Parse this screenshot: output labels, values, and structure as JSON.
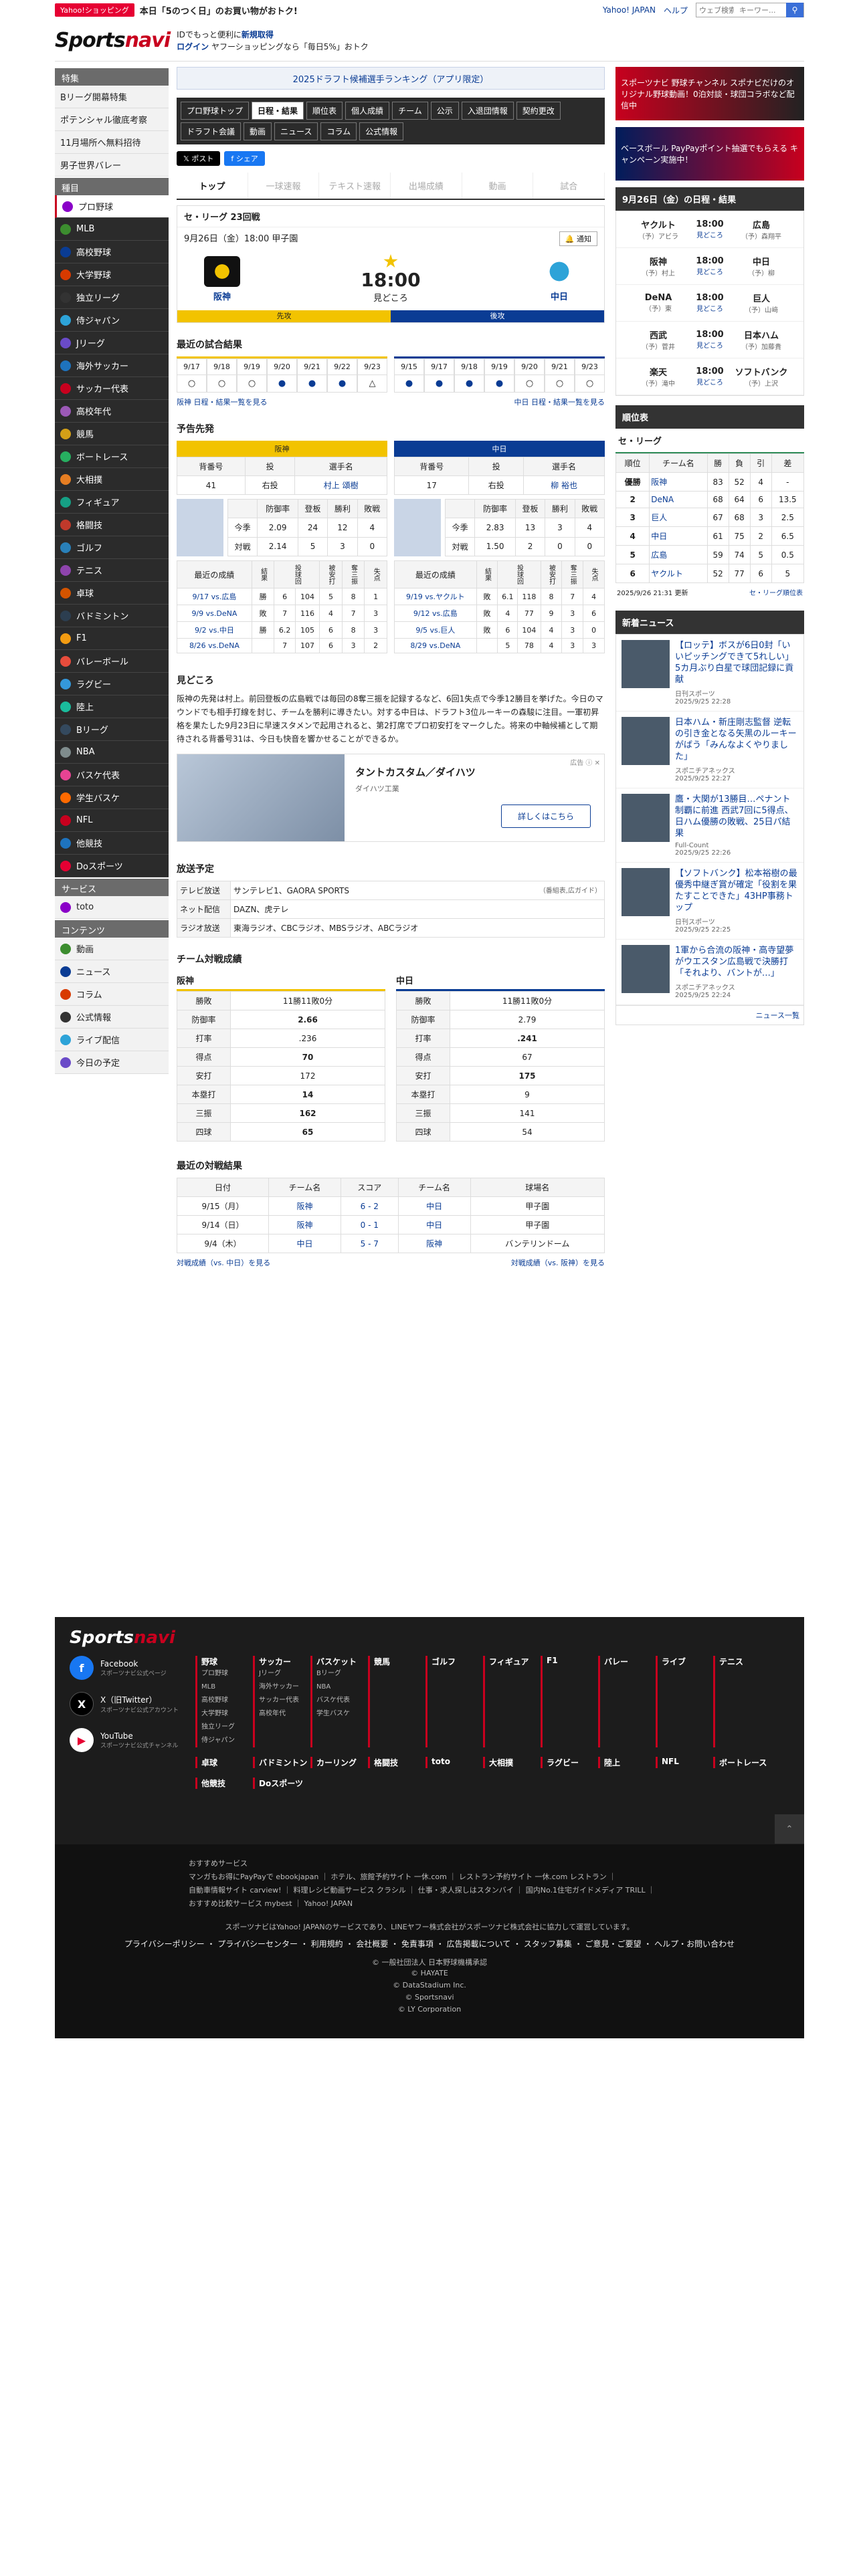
{
  "topbar": {
    "badge": "Yahoo!ショッピング",
    "promo": "本日「5のつく日」のお買い物がおトク!",
    "links": [
      "Yahoo! JAPAN",
      "ヘルプ"
    ],
    "search_placeholder": "ウェブ検索",
    "search_placeholder2": "キーワー..."
  },
  "header": {
    "logo_a": "Sports",
    "logo_b": "navi",
    "line1": "IDでもっと便利に",
    "line1b": "新規取得",
    "line2": "ログイン",
    "line2b": "ヤフーショッピングなら「毎日5%」おトク"
  },
  "sidebar": {
    "sections": [
      {
        "title": "特集",
        "items": [
          "Bリーグ開幕特集",
          "ポテンシャル徹底考察",
          "11月場所へ無料招待",
          "男子世界バレー"
        ]
      },
      {
        "title": "種目",
        "items": [
          "プロ野球",
          "MLB",
          "高校野球",
          "大学野球",
          "独立リーグ",
          "侍ジャパン",
          "Jリーグ",
          "海外サッカー",
          "サッカー代表",
          "高校年代",
          "競馬",
          "ボートレース",
          "大相撲",
          "フィギュア",
          "格闘技",
          "ゴルフ",
          "テニス",
          "卓球",
          "バドミントン",
          "F1",
          "バレーボール",
          "ラグビー",
          "陸上",
          "Bリーグ",
          "NBA",
          "バスケ代表",
          "学生バスケ",
          "NFL",
          "他競技",
          "Doスポーツ"
        ]
      },
      {
        "title": "サービス",
        "items": [
          "toto"
        ]
      },
      {
        "title": "コンテンツ",
        "items": [
          "動画",
          "ニュース",
          "コラム",
          "公式情報",
          "ライブ配信",
          "今日の予定"
        ]
      }
    ],
    "icon_colors": [
      "#ff6a00",
      "#c8001e",
      "#1e73be",
      "#e60033",
      "#8a00c8",
      "#3c8d2f",
      "#0a3c94",
      "#d83a00",
      "#333",
      "#2da3d8",
      "#6a4bc8",
      "#1e73be",
      "#c8001e",
      "#9b59b6",
      "#d4a017",
      "#27ae60",
      "#e67e22",
      "#16a085",
      "#c0392b",
      "#2980b9",
      "#8e44ad",
      "#d35400",
      "#2c3e50",
      "#f39c12",
      "#e74c3c",
      "#3498db",
      "#1abc9c",
      "#34495e",
      "#7f8c8d",
      "#e84393"
    ]
  },
  "main": {
    "rank_banner": "2025ドラフト候補選手ランキング（アプリ限定）",
    "tabs": [
      "プロ野球トップ",
      "日程・結果",
      "順位表",
      "個人成績",
      "チーム",
      "公示",
      "入退団情報",
      "契約更改",
      "ドラフト会議",
      "動画",
      "ニュース",
      "コラム",
      "公式情報"
    ],
    "share": [
      "𝕏 ポスト",
      "f シェア"
    ],
    "subtabs": [
      "トップ",
      "一球速報",
      "テキスト速報",
      "出場成績",
      "動画",
      "試合"
    ],
    "game": {
      "league": "セ・リーグ 23回戦",
      "date": "9月26日（金）18:00 甲子園",
      "notify": "通知",
      "home": "阪神",
      "away": "中日",
      "time": "18:00",
      "status": "見どころ",
      "home_sp": "先攻",
      "away_sp": "後攻"
    },
    "recent": {
      "title": "最近の試合結果",
      "left_dates": [
        "9/17",
        "9/18",
        "9/19",
        "9/20",
        "9/21",
        "9/22",
        "9/23"
      ],
      "left_marks": [
        "○",
        "○",
        "○",
        "●",
        "●",
        "●",
        "△"
      ],
      "right_dates": [
        "9/15",
        "9/17",
        "9/18",
        "9/19",
        "9/20",
        "9/21",
        "9/23"
      ],
      "right_marks": [
        "●",
        "●",
        "●",
        "●",
        "○",
        "○",
        "○"
      ],
      "left_link": "阪神 日程・結果一覧を見る",
      "right_link": "中日 日程・結果一覧を見る"
    },
    "pitchers": {
      "title": "予告先発",
      "left": {
        "team": "阪神",
        "h_no": "背番号",
        "h_pos": "投",
        "h_name": "選手名",
        "no": "41",
        "pos": "右投",
        "name": "村上 頌樹",
        "cols": [
          "防御率",
          "登板",
          "勝利",
          "敗戦"
        ],
        "rows": [
          [
            "今季",
            "2.09",
            "24",
            "12",
            "4"
          ],
          [
            "対戦",
            "2.14",
            "5",
            "3",
            "0"
          ]
        ],
        "games_h": "最近の成績",
        "gcols": [
          "結果",
          "投球回",
          "被安打",
          "奪三振",
          "失点"
        ],
        "games": [
          [
            "9/17 vs.広島",
            "勝",
            "6",
            "104",
            "5",
            "8",
            "1"
          ],
          [
            "9/9 vs.DeNA",
            "敗",
            "7",
            "116",
            "4",
            "7",
            "3"
          ],
          [
            "9/2 vs.中日",
            "勝",
            "6.2",
            "105",
            "6",
            "8",
            "3"
          ],
          [
            "8/26 vs.DeNA",
            "",
            "7",
            "107",
            "6",
            "3",
            "2"
          ]
        ]
      },
      "right": {
        "team": "中日",
        "h_no": "背番号",
        "h_pos": "投",
        "h_name": "選手名",
        "no": "17",
        "pos": "右投",
        "name": "柳 裕也",
        "cols": [
          "防御率",
          "登板",
          "勝利",
          "敗戦"
        ],
        "rows": [
          [
            "今季",
            "2.83",
            "13",
            "3",
            "4"
          ],
          [
            "対戦",
            "1.50",
            "2",
            "0",
            "0"
          ]
        ],
        "games_h": "最近の成績",
        "gcols": [
          "結果",
          "投球回",
          "被安打",
          "奪三振",
          "失点"
        ],
        "games": [
          [
            "9/19 vs.ヤクルト",
            "敗",
            "6.1",
            "118",
            "8",
            "7",
            "4"
          ],
          [
            "9/12 vs.広島",
            "敗",
            "4",
            "77",
            "9",
            "3",
            "6"
          ],
          [
            "9/5 vs.巨人",
            "敗",
            "6",
            "104",
            "4",
            "3",
            "0"
          ],
          [
            "8/29 vs.DeNA",
            "",
            "5",
            "78",
            "4",
            "3",
            "3"
          ]
        ]
      }
    },
    "highlights": {
      "title": "見どころ",
      "text": "阪神の先発は村上。前回登板の広島戦では毎回の8奪三振を記録するなど、6回1失点で今季12勝目を挙げた。今日のマウンドでも相手打線を封じ、チームを勝利に導きたい。対する中日は、ドラフト3位ルーキーの森駿に注目。一軍初昇格を果たした9月23日に早速スタメンで起用されると、第2打席でプロ初安打をマークした。将来の中軸候補として期待される背番号31は、今日も快音を響かせることができるか。"
    },
    "ad": {
      "label": "広告 ⓘ ✕",
      "title": "タントカスタム／ダイハツ",
      "sub": "ダイハツ工業",
      "button": "詳しくはこちら"
    },
    "broadcast": {
      "title": "放送予定",
      "rows": [
        [
          "テレビ放送",
          "サンテレビ1、GAORA SPORTS"
        ],
        [
          "ネット配信",
          "DAZN、虎テレ"
        ],
        [
          "ラジオ放送",
          "東海ラジオ、CBCラジオ、MBSラジオ、ABCラジオ"
        ]
      ],
      "guide": "（番組表,広ガイド）"
    },
    "stats": {
      "title": "チーム対戦成績",
      "left_team": "阪神",
      "right_team": "中日",
      "labels": [
        "勝敗",
        "防御率",
        "打率",
        "得点",
        "安打",
        "本塁打",
        "三振",
        "四球"
      ],
      "left": [
        "11勝11敗0分",
        "2.66",
        ".236",
        "70",
        "172",
        "14",
        "162",
        "65"
      ],
      "right": [
        "11勝11敗0分",
        "2.79",
        ".241",
        "67",
        "175",
        "9",
        "141",
        "54"
      ]
    },
    "vs": {
      "title": "最近の対戦結果",
      "headers": [
        "日付",
        "チーム名",
        "スコア",
        "チーム名",
        "球場名"
      ],
      "rows": [
        [
          "9/15（月）",
          "阪神",
          "6 - 2",
          "中日",
          "甲子園"
        ],
        [
          "9/14（日）",
          "阪神",
          "0 - 1",
          "中日",
          "甲子園"
        ],
        [
          "9/4（木）",
          "中日",
          "5 - 7",
          "阪神",
          "バンテリンドーム"
        ]
      ],
      "left_link": "対戦成績（vs. 中日）を見る",
      "right_link": "対戦成績（vs. 阪神）を見る"
    }
  },
  "right": {
    "banner1": "スポーツナビ 野球チャンネル スポナビだけのオリジナル野球動画！0泊対談・球団コラボなど配信中",
    "banner2": "ベースボール PayPayポイント抽選でもらえる キャンペーン実施中！",
    "games_title": "9月26日（金）の日程・結果",
    "games": [
      [
        "ヤクルト",
        "（予）アビラ",
        "18:00",
        "見どころ",
        "広島",
        "（予）森翔平"
      ],
      [
        "阪神",
        "（予）村上",
        "18:00",
        "見どころ",
        "中日",
        "（予）柳"
      ],
      [
        "DeNA",
        "（予）東",
        "18:00",
        "見どころ",
        "巨人",
        "（予）山﨑"
      ],
      [
        "西武",
        "（予）菅井",
        "18:00",
        "見どころ",
        "日本ハム",
        "（予）加藤貴"
      ],
      [
        "楽天",
        "（予）滝中",
        "18:00",
        "見どころ",
        "ソフトバンク",
        "（予）上沢"
      ]
    ],
    "stand_title": "順位表",
    "stand_tab": "セ・リーグ",
    "stand_headers": [
      "順位",
      "チーム名",
      "勝",
      "負",
      "引",
      "差"
    ],
    "standings": [
      [
        "優勝",
        "阪神",
        "83",
        "52",
        "4",
        "-"
      ],
      [
        "2",
        "DeNA",
        "68",
        "64",
        "6",
        "13.5"
      ],
      [
        "3",
        "巨人",
        "67",
        "68",
        "3",
        "2.5"
      ],
      [
        "4",
        "中日",
        "61",
        "75",
        "2",
        "6.5"
      ],
      [
        "5",
        "広島",
        "59",
        "74",
        "5",
        "0.5"
      ],
      [
        "6",
        "ヤクルト",
        "52",
        "77",
        "6",
        "5"
      ]
    ],
    "stand_update": "2025/9/26 21:31 更新",
    "stand_link": "セ・リーグ順位表",
    "news_title": "新着ニュース",
    "news": [
      [
        "【ロッテ】ボスが6日0封「いいピッチングできて5れしい」5カ月ぶり白星で球団記録に貢献",
        "日刊スポーツ",
        "2025/9/25 22:28"
      ],
      [
        "日本ハム・新庄剛志監督 逆転の引き金となる矢黒のルーキーがばう「みんなよくやりました」",
        "スポニチアネックス",
        "2025/9/25 22:27"
      ],
      [
        "鷹・大関が13勝目…ペナント制覇に前進 西武7回に5得点、日ハム優勝の敗戦、25日パ結果",
        "Full-Count",
        "2025/9/25 22:26"
      ],
      [
        "【ソフトバンク】松本裕樹の最優秀中継ぎ賞が確定「役割を果たすことできた」43HP事務トップ",
        "日刊スポーツ",
        "2025/9/25 22:25"
      ],
      [
        "1軍から合流の阪神・高寺望夢がウエスタン広島戦で決勝打「それより、バントが…」",
        "スポニチアネックス",
        "2025/9/25 22:24"
      ]
    ],
    "news_more": "ニュース一覧"
  },
  "footer": {
    "logo_a": "Sports",
    "logo_b": "navi",
    "social": [
      [
        "Facebook",
        "スポーツナビ公式ページ"
      ],
      [
        "X（旧Twitter）",
        "スポーツナビ公式アカウント"
      ],
      [
        "YouTube",
        "スポーツナビ公式チャンネル"
      ]
    ],
    "cols": [
      [
        "野球",
        "プロ野球 MLB 高校野球 大学野球 独立リーグ 侍ジャパン"
      ],
      [
        "サッカー",
        "Jリーグ 海外サッカー サッカー代表 高校年代"
      ],
      [
        "バスケット",
        "Bリーグ NBA バスケ代表 学生バスケ"
      ],
      [
        "競馬",
        ""
      ],
      [
        "ゴルフ",
        ""
      ],
      [
        "フィギュア",
        ""
      ],
      [
        "F1",
        ""
      ],
      [
        "バレー",
        ""
      ],
      [
        "ライブ",
        ""
      ],
      [
        "テニス",
        ""
      ],
      [
        "卓球",
        ""
      ],
      [
        "バドミントン",
        ""
      ],
      [
        "カーリング",
        ""
      ],
      [
        "格闘技",
        ""
      ],
      [
        "toto",
        ""
      ],
      [
        "大相撲",
        ""
      ],
      [
        "ラグビー",
        ""
      ],
      [
        "陸上",
        ""
      ],
      [
        "NFL",
        ""
      ],
      [
        "ボートレース",
        ""
      ],
      [
        "他競技",
        ""
      ],
      [
        "Doスポーツ",
        ""
      ]
    ],
    "svc_title": "おすすめサービス",
    "svc1": "マンガもお得にPayPayで ebookjapan ｜ ホテル、旅館予約サイト 一休.com ｜ レストラン予約サイト 一休.com レストラン ｜",
    "svc2": "自動車情報サイト carview! ｜ 料理レシピ動画サービス クラシル ｜ 仕事・求人探しはスタンバイ ｜ 国内No.1住宅ガイドメディア TRILL ｜",
    "svc3": "おすすめ比較サービス mybest ｜ Yahoo! JAPAN",
    "notice": "スポーツナビはYahoo! JAPANのサービスであり、LINEヤフー株式会社がスポーツナビ株式会社に協力して運営しています。",
    "links": "プライバシーポリシー ・ プライバシーセンター ・ 利用規約 ・ 会社概要 ・ 免責事項 ・ 広告掲載について ・ スタッフ募集 ・ ご意見・ご要望 ・ ヘルプ・お問い合わせ",
    "copy": [
      "© 一般社団法人 日本野球機構承認",
      "© HAYATE",
      "© DataStadium Inc.",
      "© Sportsnavi",
      "© LY Corporation"
    ]
  }
}
